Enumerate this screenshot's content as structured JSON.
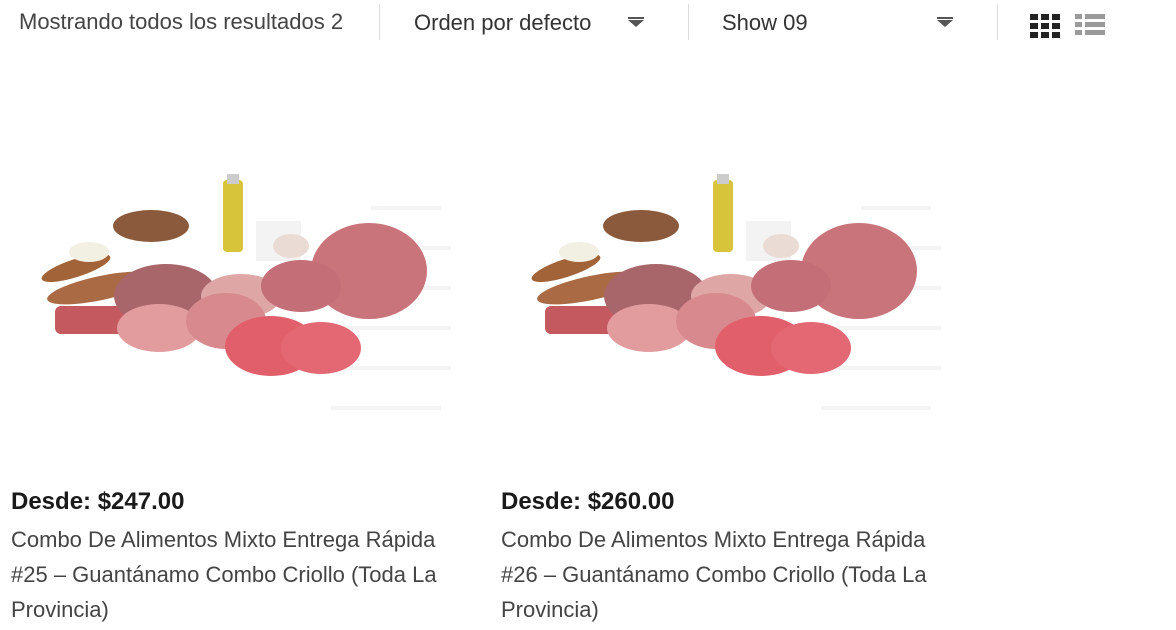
{
  "toolbar": {
    "result_count": "Mostrando todos los resultados 2",
    "orderby_label": "Orden por defecto",
    "show_label": "Show 09"
  },
  "products": [
    {
      "price": "Desde: $247.00",
      "title": "Combo De Alimentos Mixto Entrega Rápida #25 – Guantánamo Combo Criollo (Toda La Provincia)"
    },
    {
      "price": "Desde: $260.00",
      "title": "Combo De Alimentos Mixto Entrega Rápida #26 – Guantánamo Combo Criollo (Toda La Provincia)"
    }
  ],
  "icons": {
    "grid_view": "grid-view-icon",
    "list_view": "list-view-icon",
    "dropdown": "chevron-down-icon"
  }
}
